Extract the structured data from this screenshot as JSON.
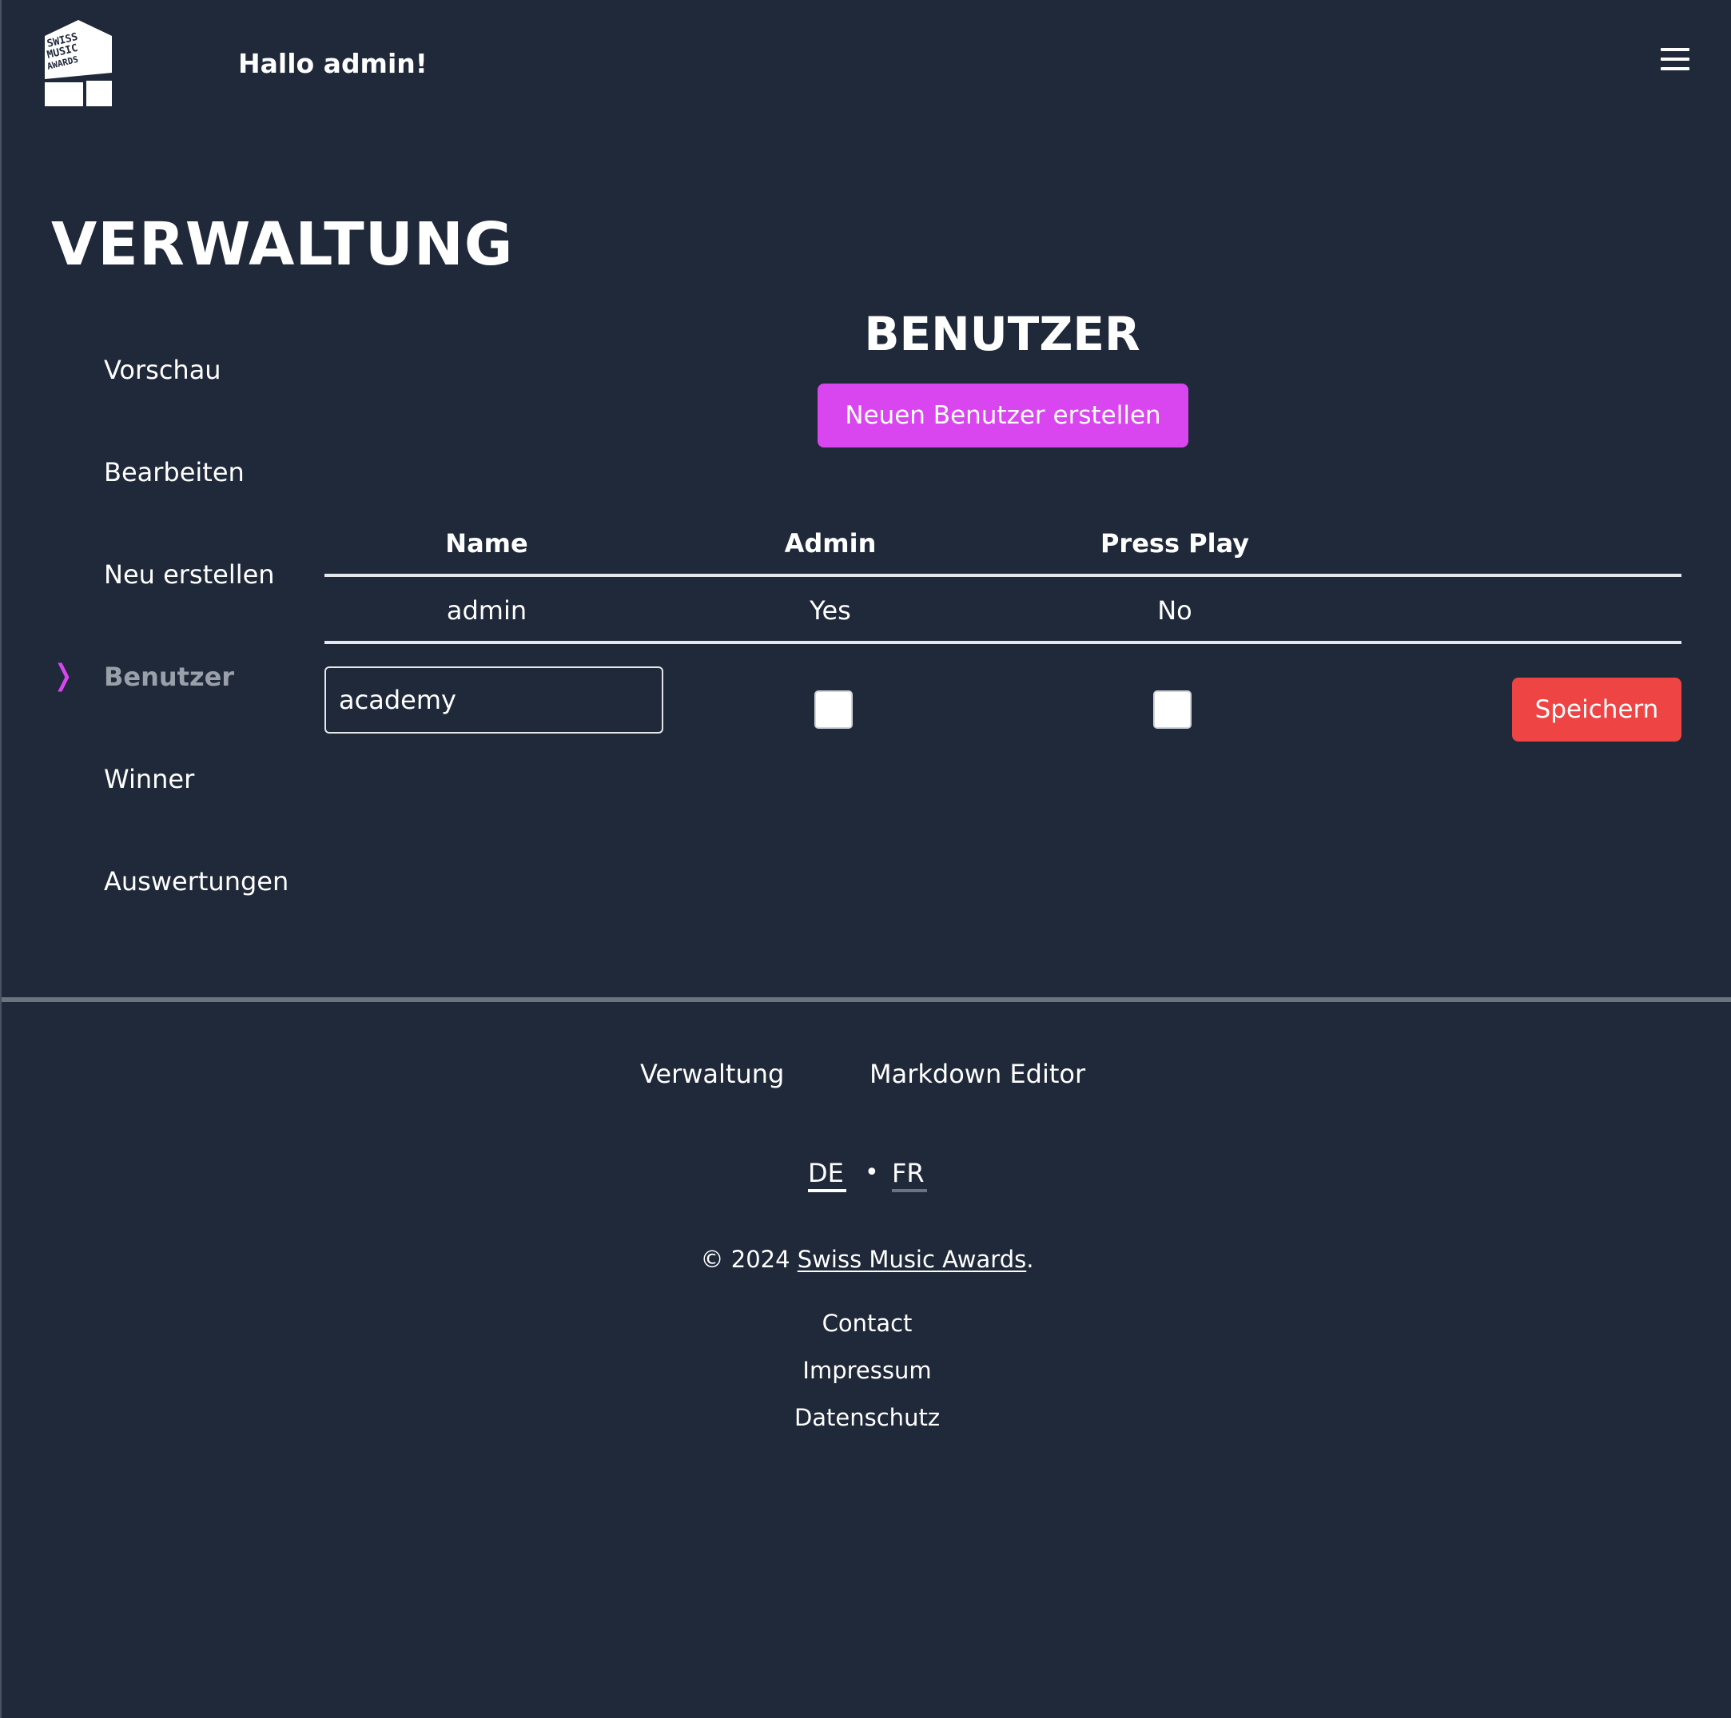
{
  "header": {
    "logo_alt": "Swiss Music Awards logo",
    "greeting": "Hallo admin!",
    "menu_icon": "hamburger-menu-icon"
  },
  "page": {
    "title": "VERWALTUNG"
  },
  "sidebar": {
    "active_marker": "❭",
    "items": [
      {
        "label": "Vorschau"
      },
      {
        "label": "Bearbeiten"
      },
      {
        "label": "Neu erstellen"
      },
      {
        "label": "Benutzer",
        "active": true
      },
      {
        "label": "Winner"
      },
      {
        "label": "Auswertungen"
      }
    ]
  },
  "users": {
    "title": "BENUTZER",
    "create_label": "Neuen Benutzer erstellen",
    "columns": [
      "Name",
      "Admin",
      "Press Play"
    ],
    "rows": [
      {
        "name": "admin",
        "admin": "Yes",
        "press_play": "No"
      }
    ],
    "new_user": {
      "name_value": "academy",
      "admin_checked": false,
      "press_play_checked": false,
      "save_label": "Speichern"
    }
  },
  "footer": {
    "nav": [
      "Verwaltung",
      "Markdown Editor"
    ],
    "languages": [
      "DE",
      "FR"
    ],
    "language_separator": "•",
    "copyright_prefix": "© 2024",
    "copyright_link": "Swiss Music Awards",
    "copyright_suffix": ".",
    "links": [
      "Contact",
      "Impressum",
      "Datenschutz"
    ]
  },
  "colors": {
    "background": "#20293a",
    "accent_magenta": "#d946ef",
    "save_red": "#ef4444",
    "text": "#ffffff",
    "muted_text": "#9aa0aa"
  }
}
